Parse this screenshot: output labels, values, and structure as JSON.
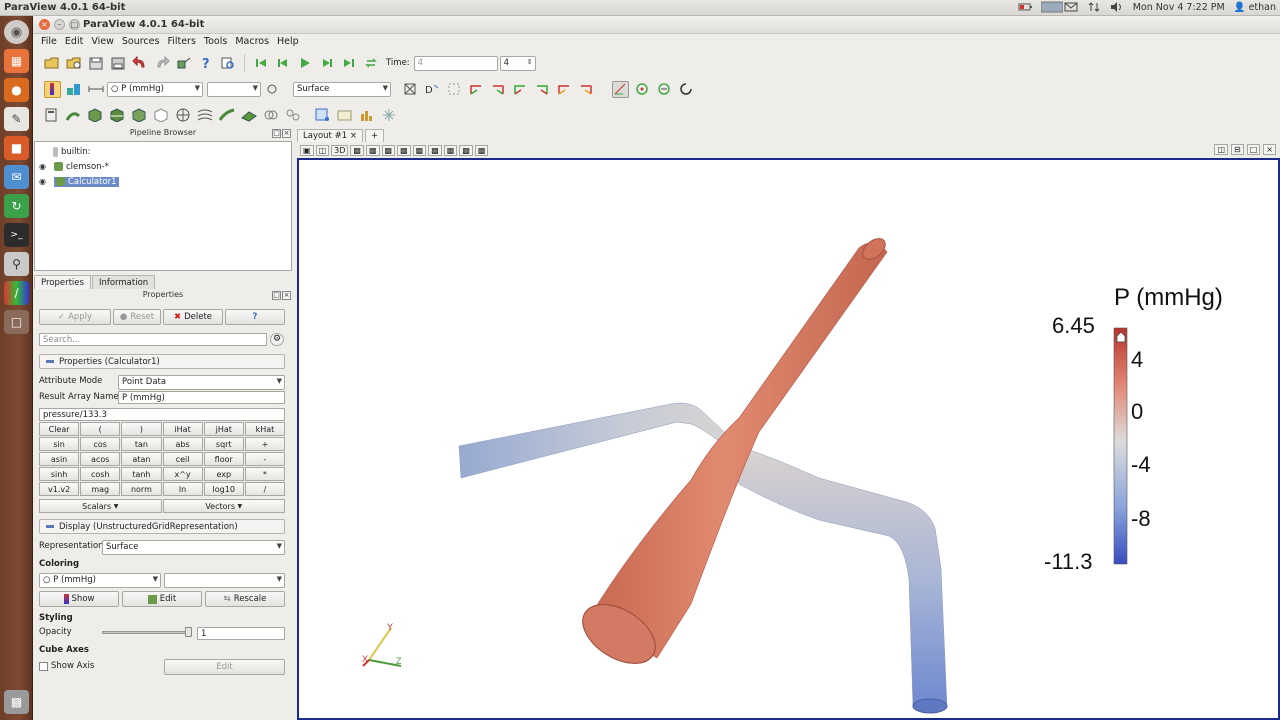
{
  "system": {
    "app_title": "ParaView 4.0.1 64-bit",
    "clock": "Mon Nov 4  7:22 PM",
    "user": "ethan",
    "tray_icons": [
      "battery-icon",
      "keyboard-layout-icon",
      "mail-icon",
      "network-icon",
      "volume-icon"
    ]
  },
  "launcher": {
    "items": [
      "dash-icon",
      "files-icon",
      "firefox-icon",
      "text-editor-icon",
      "software-center-icon",
      "thunderbird-icon",
      "update-icon",
      "terminal-icon",
      "search-magnifier-icon",
      "paraview-icon",
      "workspace-icon",
      "trash-icon"
    ]
  },
  "window": {
    "title": "ParaView 4.0.1 64-bit"
  },
  "menu": [
    "File",
    "Edit",
    "View",
    "Sources",
    "Filters",
    "Tools",
    "Macros",
    "Help"
  ],
  "time_toolbar": {
    "time_label": "Time:",
    "time_value": "4",
    "step_value": "4"
  },
  "active_variable": {
    "array_name": "P (mmHg)",
    "component": "",
    "representation": "Surface"
  },
  "pipeline_browser": {
    "title": "Pipeline Browser",
    "items": [
      {
        "label": "builtin:"
      },
      {
        "label": "clemson-*"
      },
      {
        "label": "Calculator1",
        "selected": true
      }
    ]
  },
  "tabs": {
    "properties": "Properties",
    "information": "Information"
  },
  "properties": {
    "title": "Properties",
    "apply": "Apply",
    "reset": "Reset",
    "delete": "Delete",
    "help": "?",
    "search_placeholder": "Search...",
    "section_properties": "Properties (Calculator1)",
    "attribute_mode_label": "Attribute Mode",
    "attribute_mode_value": "Point Data",
    "result_array_label": "Result Array Name",
    "result_array_value": "P (mmHg)",
    "expression": "pressure/133.3",
    "calc_keys": [
      "Clear",
      "(",
      ")",
      "iHat",
      "jHat",
      "kHat",
      "sin",
      "cos",
      "tan",
      "abs",
      "sqrt",
      "+",
      "asin",
      "acos",
      "atan",
      "ceil",
      "floor",
      "-",
      "sinh",
      "cosh",
      "tanh",
      "x^y",
      "exp",
      "*",
      "v1.v2",
      "mag",
      "norm",
      "ln",
      "log10",
      "/"
    ],
    "scalars": "Scalars",
    "vectors": "Vectors",
    "section_display": "Display (UnstructuredGridRepresentation)",
    "representation_label": "Representation",
    "representation_value": "Surface",
    "coloring_label": "Coloring",
    "coloring_value": "P (mmHg)",
    "coloring_component": "",
    "show": "Show",
    "edit": "Edit",
    "rescale": "Rescale",
    "styling_label": "Styling",
    "opacity_label": "Opacity",
    "opacity_value": "1",
    "cube_axes_label": "Cube Axes",
    "show_axis_label": "Show Axis",
    "cube_edit": "Edit"
  },
  "layout": {
    "tab": "Layout #1",
    "add_tab": "+",
    "view_3d": "3D"
  },
  "viewport": {
    "background": "#ffffff",
    "colorbar": {
      "title": "P (mmHg)",
      "max_label": "6.45",
      "min_label": "-11.3",
      "ticks": [
        "4",
        "0",
        "-4",
        "-8"
      ],
      "colors": {
        "high": "#b8342e",
        "mid": "#dcdcdc",
        "low": "#3b4cc0"
      }
    },
    "axes": {
      "x": "X",
      "y": "Y",
      "z": "Z"
    }
  },
  "colors": {
    "accent_selected": "#6b8cc7",
    "artery_warm": "#d67a62",
    "artery_cool": "#7f98d0"
  }
}
